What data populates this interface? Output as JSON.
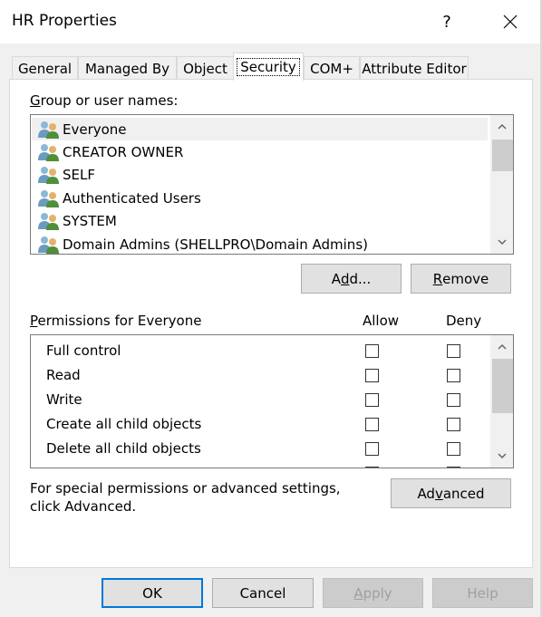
{
  "window": {
    "title": "HR Properties",
    "help_glyph": "?"
  },
  "tabs": [
    {
      "label": "General"
    },
    {
      "label": "Managed By"
    },
    {
      "label": "Object"
    },
    {
      "label": "Security"
    },
    {
      "label": "COM+"
    },
    {
      "label": "Attribute Editor"
    }
  ],
  "security": {
    "group_label": {
      "accel": "G",
      "rest": "roup or user names:"
    },
    "users": [
      {
        "name": "Everyone"
      },
      {
        "name": "CREATOR OWNER"
      },
      {
        "name": "SELF"
      },
      {
        "name": "Authenticated Users"
      },
      {
        "name": "SYSTEM"
      },
      {
        "name": "Domain Admins (SHELLPRO\\Domain Admins)"
      }
    ],
    "add_button": {
      "pre": "A",
      "accel": "d",
      "post": "d..."
    },
    "remove_button": {
      "accel": "R",
      "rest": "emove"
    },
    "permissions_label": {
      "accel": "P",
      "rest": "ermissions for Everyone"
    },
    "allow_header": "Allow",
    "deny_header": "Deny",
    "permissions": [
      {
        "name": "Full control",
        "allow": false,
        "deny": false
      },
      {
        "name": "Read",
        "allow": false,
        "deny": false
      },
      {
        "name": "Write",
        "allow": false,
        "deny": false
      },
      {
        "name": "Create all child objects",
        "allow": false,
        "deny": false
      },
      {
        "name": "Delete all child objects",
        "allow": false,
        "deny": false
      }
    ],
    "advanced_note": "For special permissions or advanced settings, click Advanced.",
    "advanced_button": {
      "pre": "Ad",
      "accel": "v",
      "post": "anced"
    }
  },
  "footer": {
    "ok": "OK",
    "cancel": "Cancel",
    "apply": {
      "accel": "A",
      "rest": "pply"
    },
    "help": "Help"
  }
}
